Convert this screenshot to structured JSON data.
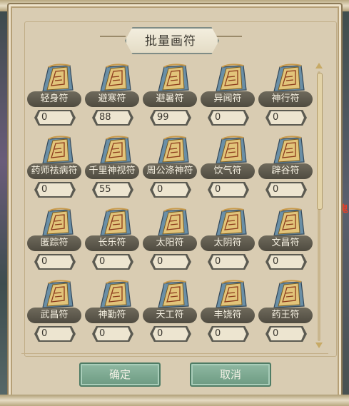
{
  "title": "批量画符",
  "background_partial_text": "鬼",
  "talismans": [
    {
      "name": "轻身符",
      "count": "0"
    },
    {
      "name": "避寒符",
      "count": "88"
    },
    {
      "name": "避暑符",
      "count": "99"
    },
    {
      "name": "异闻符",
      "count": "0"
    },
    {
      "name": "神行符",
      "count": "0"
    },
    {
      "name": "药师祛病符",
      "count": "0"
    },
    {
      "name": "千里神视符",
      "count": "55"
    },
    {
      "name": "周公涤神符",
      "count": "0"
    },
    {
      "name": "饮气符",
      "count": "0"
    },
    {
      "name": "辟谷符",
      "count": "0"
    },
    {
      "name": "匿踪符",
      "count": "0"
    },
    {
      "name": "长乐符",
      "count": "0"
    },
    {
      "name": "太阳符",
      "count": "0"
    },
    {
      "name": "太阴符",
      "count": "0"
    },
    {
      "name": "文昌符",
      "count": "0"
    },
    {
      "name": "武昌符",
      "count": "0"
    },
    {
      "name": "神勤符",
      "count": "0"
    },
    {
      "name": "天工符",
      "count": "0"
    },
    {
      "name": "丰饶符",
      "count": "0"
    },
    {
      "name": "药王符",
      "count": "0"
    }
  ],
  "buttons": {
    "confirm": "确定",
    "cancel": "取消"
  },
  "colors": {
    "panel": "#d9ccb2",
    "button": "#7fab93",
    "pill": "#5b574a"
  }
}
